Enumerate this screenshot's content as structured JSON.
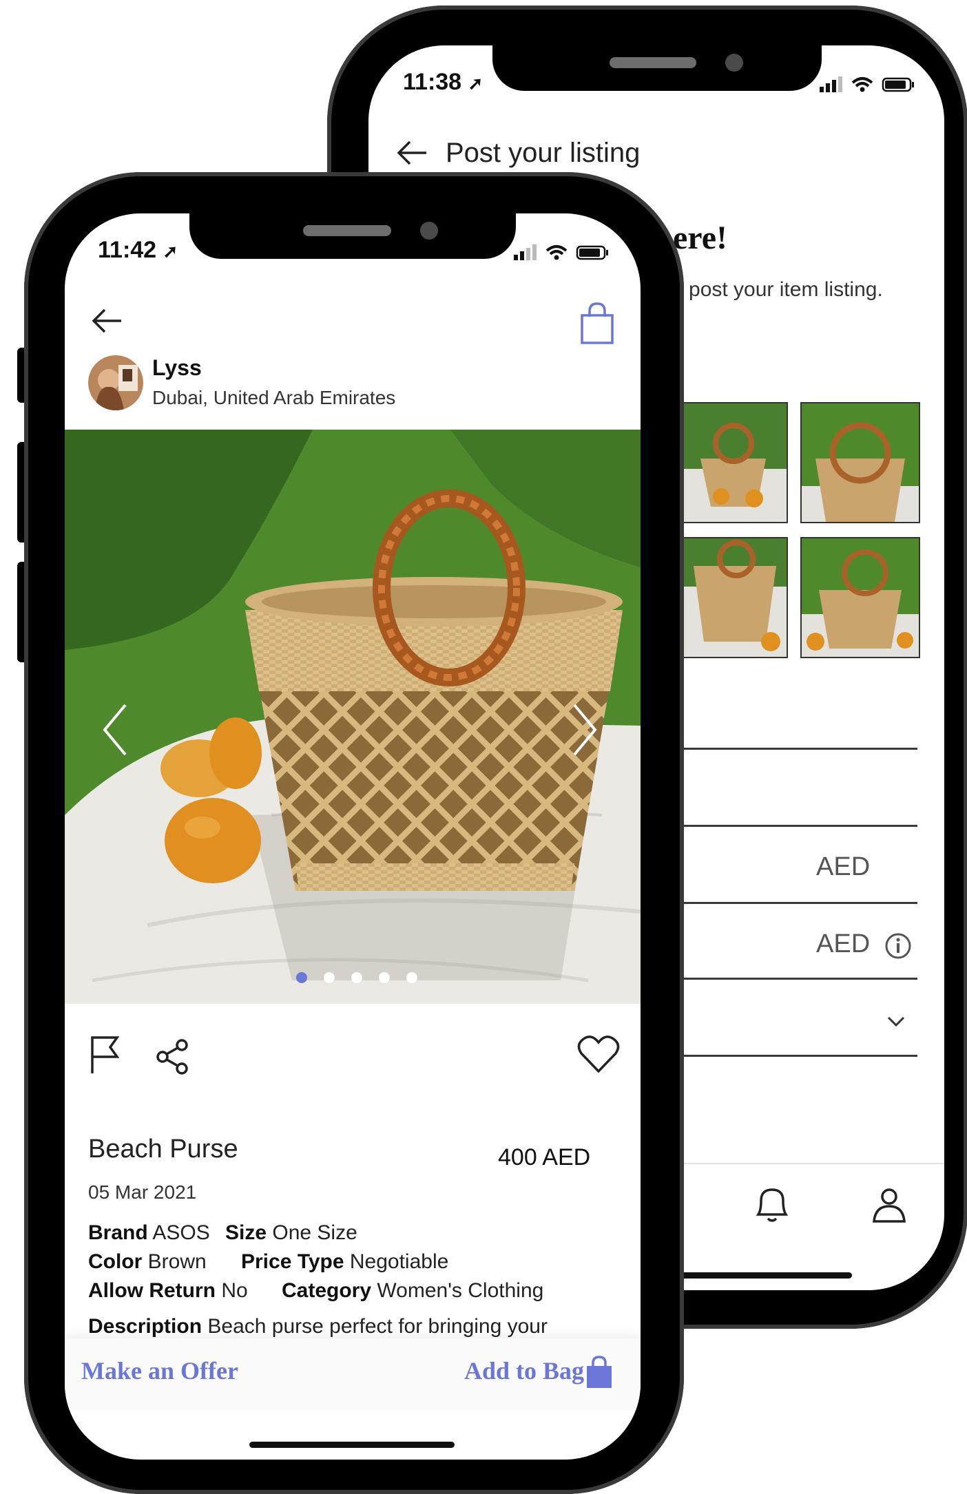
{
  "back_phone": {
    "status_time": "11:38",
    "nav_title": "Post your listing",
    "heading_fragment": "ere!",
    "subtitle_fragment": "o post your item listing.",
    "price_unit": "AED",
    "price_unit_2": "AED"
  },
  "front_phone": {
    "status_time": "11:42",
    "seller": {
      "name": "Lyss",
      "location": "Dubai, United Arab Emirates"
    },
    "carousel": {
      "total": 5,
      "active": 1
    },
    "item": {
      "title": "Beach Purse",
      "price": "400 AED",
      "date": "05 Mar 2021",
      "specs": {
        "brand_label": "Brand",
        "brand_value": "ASOS",
        "size_label": "Size",
        "size_value": "One Size",
        "color_label": "Color",
        "color_value": "Brown",
        "price_type_label": "Price Type",
        "price_type_value": "Negotiable",
        "allow_return_label": "Allow Return",
        "allow_return_value": "No",
        "category_label": "Category",
        "category_value": "Women's Clothing",
        "description_label": "Description",
        "description_value": "Beach purse perfect for bringing your"
      }
    },
    "actions": {
      "make_offer": "Make an Offer",
      "add_to_bag": "Add to Bag"
    }
  },
  "colors": {
    "accent": "#6b77d6",
    "grass": "#4e8a2c",
    "cloth": "#e8e6e1",
    "wicker": "#c9a56d",
    "orange": "#e0901f"
  }
}
